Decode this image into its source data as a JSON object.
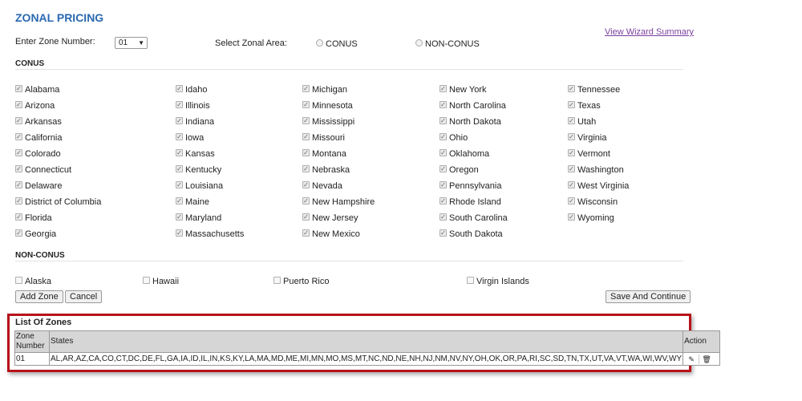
{
  "page": {
    "title": "ZONAL PRICING",
    "zone_number_label": "Enter Zone Number:",
    "zone_number_value": "01",
    "zonal_area_label": "Select Zonal Area:",
    "radio_conus": "CONUS",
    "radio_nonconus": "NON-CONUS",
    "wizard_link": "View Wizard Summary"
  },
  "conus": {
    "heading": "CONUS",
    "columns": [
      [
        "Alabama",
        "Arizona",
        "Arkansas",
        "California",
        "Colorado",
        "Connecticut",
        "Delaware",
        "District of Columbia",
        "Florida",
        "Georgia"
      ],
      [
        "Idaho",
        "Illinois",
        "Indiana",
        "Iowa",
        "Kansas",
        "Kentucky",
        "Louisiana",
        "Maine",
        "Maryland",
        "Massachusetts"
      ],
      [
        "Michigan",
        "Minnesota",
        "Mississippi",
        "Missouri",
        "Montana",
        "Nebraska",
        "Nevada",
        "New Hampshire",
        "New Jersey",
        "New Mexico"
      ],
      [
        "New York",
        "North Carolina",
        "North Dakota",
        "Ohio",
        "Oklahoma",
        "Oregon",
        "Pennsylvania",
        "Rhode Island",
        "South Carolina",
        "South Dakota"
      ],
      [
        "Tennessee",
        "Texas",
        "Utah",
        "Virginia",
        "Vermont",
        "Washington",
        "West Virginia",
        "Wisconsin",
        "Wyoming"
      ]
    ]
  },
  "nonconus": {
    "heading": "NON-CONUS",
    "items": [
      "Alaska",
      "Hawaii",
      "Puerto Rico",
      "Virgin Islands"
    ]
  },
  "buttons": {
    "add_zone": "Add Zone",
    "cancel": "Cancel",
    "save_continue": "Save And Continue"
  },
  "zones_list": {
    "heading": "List Of Zones",
    "col_zone": "Zone Number",
    "col_states": "States",
    "col_action": "Action",
    "rows": [
      {
        "zone": "01",
        "states": "AL,AR,AZ,CA,CO,CT,DC,DE,FL,GA,IA,ID,IL,IN,KS,KY,LA,MA,MD,ME,MI,MN,MO,MS,MT,NC,ND,NE,NH,NJ,NM,NV,NY,OH,OK,OR,PA,RI,SC,SD,TN,TX,UT,VA,VT,WA,WI,WV,WY"
      }
    ]
  },
  "icons": {
    "edit": "pencil-icon",
    "delete": "trash-icon"
  },
  "colors": {
    "title": "#2a6ab0",
    "link": "#7b3fa0",
    "highlight": "#b8121a"
  }
}
